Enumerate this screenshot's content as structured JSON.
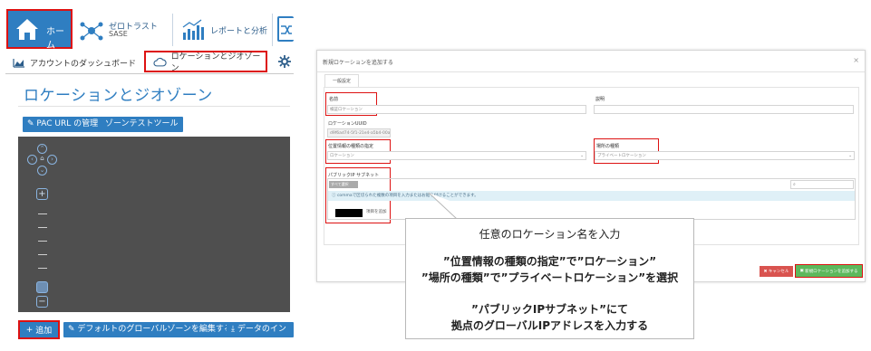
{
  "topnav": {
    "home_label": "ホーム",
    "zerotrust_label": "ゼロトラスト",
    "zerotrust_sub": "SASE",
    "reports_label": "レポートと分析"
  },
  "subnav": {
    "tab_dashboard": "アカウントのダッシュボード",
    "tab_locations": "ロケーションとジオゾーン"
  },
  "page": {
    "title": "ロケーションとジオゾーン",
    "btn_pac": "PAC URL の管理",
    "btn_zone_test": "ゾーンテストツール"
  },
  "bottom": {
    "add": "追加",
    "edit_default": "デフォルトのグローバルゾーンを編集する",
    "data_in": "データのイン"
  },
  "modal": {
    "title": "新規ロケーションを追加する",
    "close": "×",
    "tab": "一般設定",
    "name_label": "名前",
    "name_value": "検証ロケーション",
    "desc_label": "説明",
    "uuid_label": "ロケーションUUID",
    "uuid_value": "d9f6ad74-5f1-21e4-a5b4-00ae8057f1d8",
    "loc_type_label": "位置情報の種類の指定",
    "loc_type_value": "ロケーション",
    "place_type_label": "場所の種類",
    "place_type_value": "プライベートロケーション",
    "subnet_label": "パブリックIP サブネット",
    "select_all": "すべて選択",
    "info_text": "commaで区切られた複数の項目を入力またはお貼り付けることができます。",
    "add_item": "項目を追加",
    "cancel": "キャンセル",
    "submit": "新規ロケーションを追加する"
  },
  "callout": {
    "line1": "任意のロケーション名を入力",
    "line2": "”位置情報の種類の指定”で”ロケーション”",
    "line3": "”場所の種類”で”プライベートロケーション”を選択",
    "line4": "”パブリックIPサブネット”にて",
    "line5": "拠点のグローバルIPアドレスを入力する"
  },
  "colors": {
    "accent": "#2f7ec1",
    "highlight": "#dd1111",
    "success": "#5cb85c",
    "danger": "#d9534f"
  }
}
